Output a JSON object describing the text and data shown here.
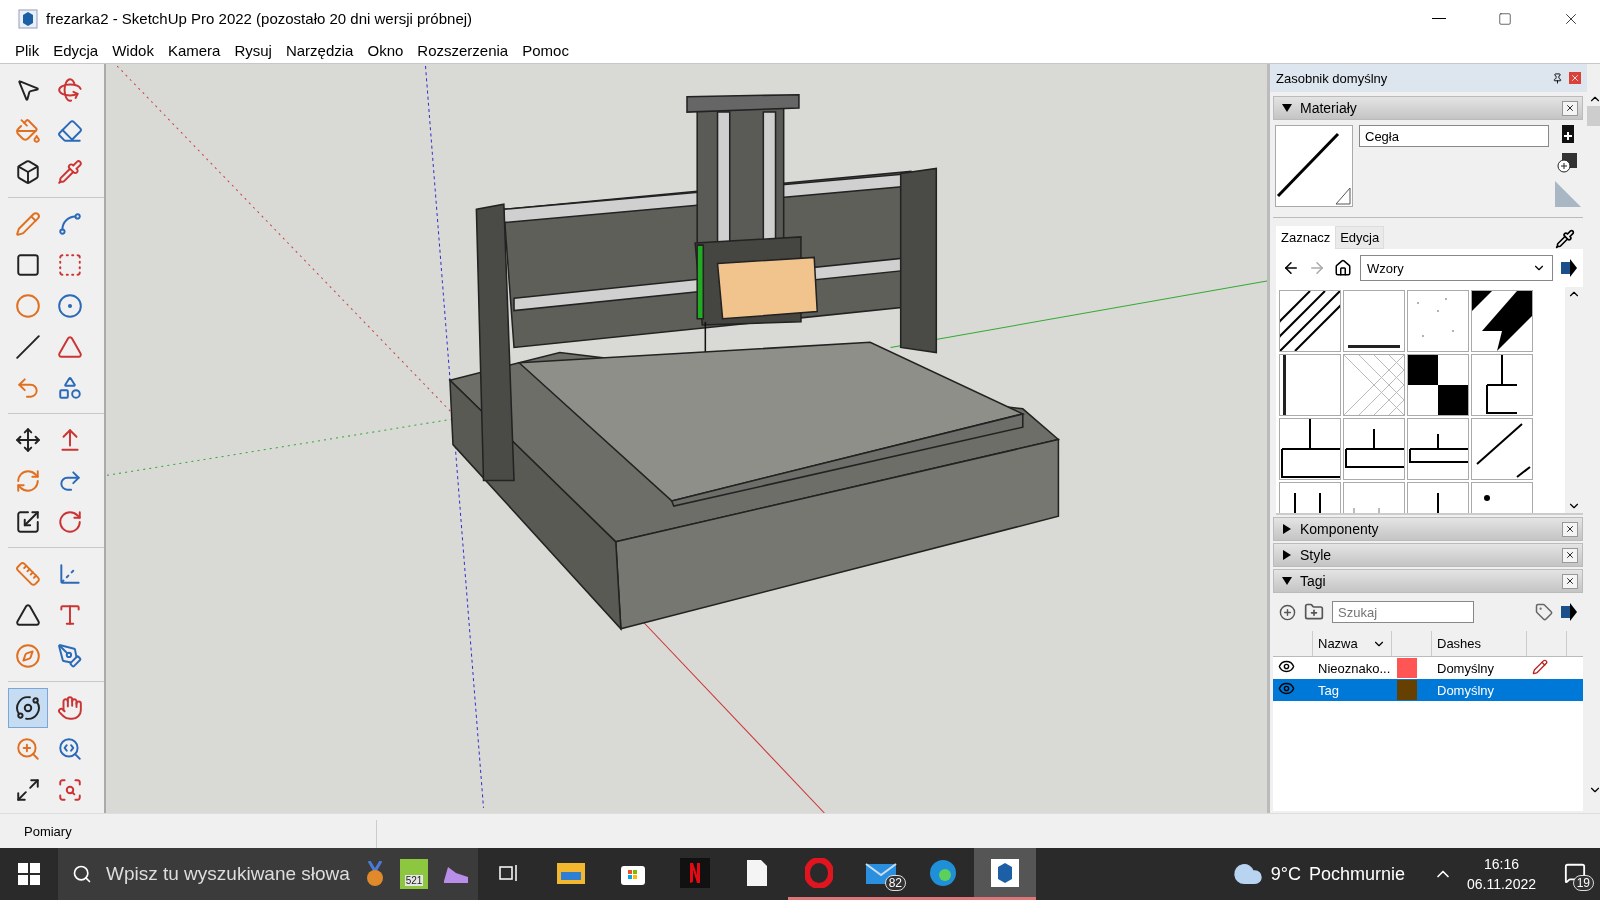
{
  "window": {
    "title": "frezarka2 - SketchUp Pro 2022 (pozostało 20 dni wersji próbnej)"
  },
  "menu": [
    "Plik",
    "Edycja",
    "Widok",
    "Kamera",
    "Rysuj",
    "Narzędzia",
    "Okno",
    "Rozszerzenia",
    "Pomoc"
  ],
  "toolbar": {
    "groups": [
      [
        {
          "selected": false
        },
        {
          "selected": false
        },
        {
          "selected": false
        },
        {
          "selected": false
        },
        {
          "selected": false
        },
        {
          "selected": false
        }
      ],
      [
        {
          "selected": false
        },
        {
          "selected": false
        },
        {
          "selected": false
        },
        {
          "selected": false
        },
        {
          "selected": false
        },
        {
          "selected": false
        },
        {
          "selected": false
        },
        {
          "selected": false
        },
        {
          "selected": false
        },
        {
          "selected": false
        }
      ],
      [
        {
          "selected": false
        },
        {
          "selected": false
        },
        {
          "selected": false
        },
        {
          "selected": false
        },
        {
          "selected": false
        },
        {
          "selected": false
        }
      ],
      [
        {
          "selected": false
        },
        {
          "selected": false
        },
        {
          "selected": false
        },
        {
          "selected": false
        },
        {
          "selected": false
        },
        {
          "selected": false
        }
      ],
      [
        {
          "selected": true
        },
        {
          "selected": false
        },
        {
          "selected": false
        },
        {
          "selected": false
        },
        {
          "selected": false
        },
        {
          "selected": false
        }
      ]
    ]
  },
  "tray": {
    "title": "Zasobnik domyślny",
    "materials": {
      "title": "Materiały",
      "expanded": true,
      "name": "Cegła",
      "tabs": [
        {
          "label": "Zaznacz",
          "selected": true
        },
        {
          "label": "Edycja",
          "selected": false
        }
      ],
      "library": "Wzory"
    },
    "panels": [
      {
        "title": "Komponenty",
        "expanded": false
      },
      {
        "title": "Style",
        "expanded": false
      }
    ],
    "tags": {
      "title": "Tagi",
      "expanded": true,
      "search": {
        "placeholder": "Szukaj"
      },
      "columns": [
        "Nazwa",
        "Dashes"
      ],
      "rows": [
        {
          "name": "Nieoznako...",
          "color": "#ff5555",
          "dashes": "Domyślny",
          "visible": true,
          "selected": false,
          "current": true
        },
        {
          "name": "Tag",
          "color": "#654000",
          "dashes": "Domyślny",
          "visible": true,
          "selected": true,
          "current": false
        }
      ]
    }
  },
  "status_bar": {
    "label": "Pomiary"
  },
  "taskbar": {
    "search": {
      "placeholder": "Wpisz tu wyszukiwane słowa"
    },
    "widget_badge": "521",
    "apps": [
      {
        "kind": "taskview",
        "running": false,
        "selected": false
      },
      {
        "kind": "explorer",
        "running": false,
        "selected": false
      },
      {
        "kind": "store",
        "running": false,
        "selected": false
      },
      {
        "kind": "netflix",
        "running": false,
        "selected": false
      },
      {
        "kind": "file",
        "running": false,
        "selected": false
      },
      {
        "kind": "opera",
        "running": true,
        "selected": false
      },
      {
        "kind": "mail",
        "running": true,
        "selected": false,
        "badge": "82"
      },
      {
        "kind": "edge",
        "running": true,
        "selected": false
      },
      {
        "kind": "sketchup",
        "running": true,
        "selected": true
      }
    ],
    "weather": {
      "temp": "9°C",
      "text": "Pochmurnie"
    },
    "time": "16:16",
    "date": "06.11.2022",
    "notifications": "19"
  }
}
